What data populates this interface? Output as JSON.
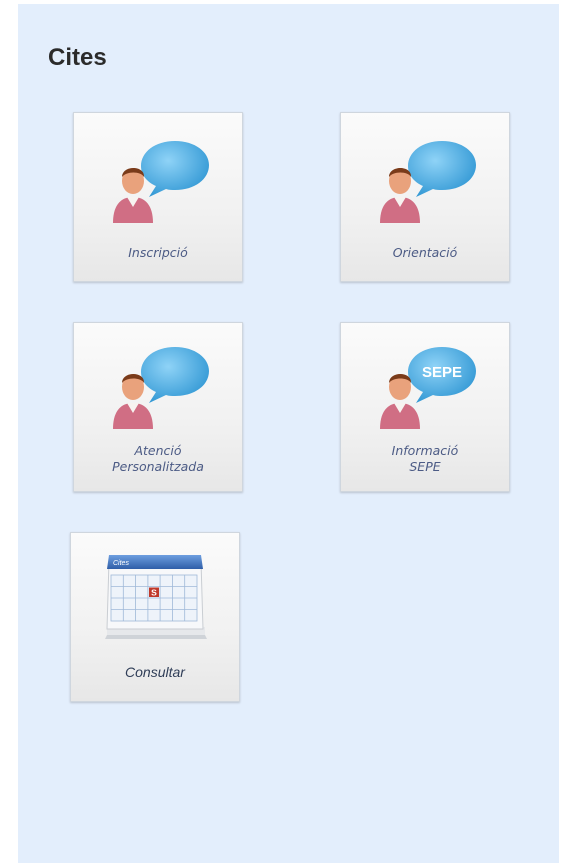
{
  "page": {
    "title": "Cites"
  },
  "tiles": [
    {
      "id": "inscripcio",
      "lines": [
        "Inscripció"
      ]
    },
    {
      "id": "orientacio",
      "lines": [
        "Orientació"
      ]
    },
    {
      "id": "atencio",
      "lines": [
        "Atenció",
        "Personalitzada"
      ]
    },
    {
      "id": "sepe",
      "lines": [
        "Informació",
        "SEPE"
      ],
      "bubble_text": "SEPE"
    },
    {
      "id": "consultar",
      "lines": [
        "Consultar"
      ],
      "calendar_header": "Cites",
      "calendar_mark": "S"
    }
  ],
  "colors": {
    "background": "#e3eefc",
    "bubble": "#3fa6df",
    "label": "#4c5b85",
    "calendar_header": "#3d6fb6",
    "calendar_mark": "#c0392b"
  },
  "icons": {
    "person_bubble": "person-speech-bubble-icon",
    "calendar": "calendar-icon"
  }
}
